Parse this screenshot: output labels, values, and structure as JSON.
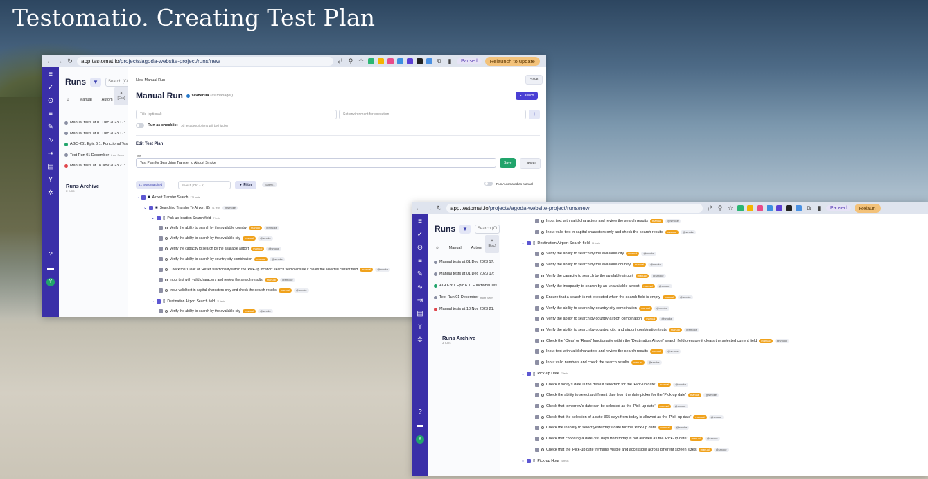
{
  "slide_title": "Testomatio. Creating Test Plan",
  "browser": {
    "url_host": "app.testomat.io",
    "url_path": "/projects/agoda-website-project/runs/new",
    "paused": "Paused",
    "relaunch": "Relaunch to update",
    "relaunch_short": "Relaun"
  },
  "runs_panel": {
    "title": "Runs",
    "search_placeholder": "Search (Ctrl",
    "esc_x": "×",
    "esc_label": "[Esc]",
    "tab_manual": "Manual",
    "tab_auto": "Autom",
    "items": [
      {
        "label": "Manual tests at 01 Dec 2023 17:",
        "color": "#8a8fa3",
        "from": ""
      },
      {
        "label": "Manual tests at 01 Dec 2023 17:",
        "color": "#8a8fa3",
        "from": ""
      },
      {
        "label": "AGO-261 Epic 6.1: Functional Tes",
        "color": "#21a46b",
        "from": ""
      },
      {
        "label": "Test Run 01 December",
        "color": "#8a8fa3",
        "from": "from Seen"
      },
      {
        "label": "Manual tests at 18 Nov 2023 21:",
        "color": "#e0464c",
        "from": ""
      }
    ],
    "archive_title": "Runs Archive",
    "archive_sub": "3 runs"
  },
  "manual_run": {
    "breadcrumb": "New Manual Run",
    "save_top": "Save",
    "title": "Manual Run",
    "manager_name": "Yevheniia",
    "manager_role": "(as manager)",
    "launch": "▸ Launch",
    "title_placeholder": "Title (optional)",
    "env_placeholder": "Set environment for execution",
    "plus": "+",
    "checklist_label": "Run as checklist",
    "checklist_hint": "All test descriptions will be hidden",
    "edit_plan": "Edit Test Plan",
    "title_label": "Title",
    "title_value": "Test Plan for Searching Transfer to Airport Smoke",
    "save": "Save",
    "cancel": "Cancel",
    "tests_matched": "41 tests matched",
    "search_placeholder": "Search [Ctrl + K]",
    "filter": "Filter",
    "suites_badge": "Suites/1",
    "run_automated": "Run Automated as Manual"
  },
  "tree1": [
    {
      "kind": "folder",
      "indent": 0,
      "label": "Airport Transfer Search",
      "count": "173 tests",
      "tag": ""
    },
    {
      "kind": "folder",
      "indent": 1,
      "label": "Searching Transfer To Airport (2)",
      "count": "41 tests",
      "tag": "@smoke"
    },
    {
      "kind": "suite",
      "indent": 2,
      "label": "Pick-up location Search field",
      "count": "7 tests",
      "tag": ""
    },
    {
      "kind": "test",
      "indent": 3,
      "label": "Verify the ability to search by the available country"
    },
    {
      "kind": "test",
      "indent": 3,
      "label": "Verify the ability to search by the available city"
    },
    {
      "kind": "test",
      "indent": 3,
      "label": "Verify the capacity to search by the available airport"
    },
    {
      "kind": "test",
      "indent": 3,
      "label": "Verify the ability to search by country-city combination"
    },
    {
      "kind": "test",
      "indent": 3,
      "label": "Check the 'Clear' or 'Reset' functionality within the 'Pick-up location' search fieldto ensure it clears the selected current field"
    },
    {
      "kind": "test",
      "indent": 3,
      "label": "Input text with valid characters and review the search results"
    },
    {
      "kind": "test",
      "indent": 3,
      "label": "Input valid text in capital characters only and check the search results"
    },
    {
      "kind": "suite",
      "indent": 2,
      "label": "Destination Airport Search field",
      "count": "11 tests",
      "tag": ""
    },
    {
      "kind": "test",
      "indent": 3,
      "label": "Verify the ability to search by the available city"
    }
  ],
  "tree2": [
    {
      "kind": "test",
      "label": "Input text with valid characters and review the search results"
    },
    {
      "kind": "test",
      "label": "Input valid text in capital characters only and check the search results"
    },
    {
      "kind": "suite",
      "label": "Destination Airport Search field",
      "count": "11 tests"
    },
    {
      "kind": "test",
      "label": "Verify the ability to search by the available city"
    },
    {
      "kind": "test",
      "label": "Verify the ability to search by the available country"
    },
    {
      "kind": "test",
      "label": "Verify the capacity to search by the available airport"
    },
    {
      "kind": "test",
      "label": "Verify the incapacity to search by an unavailable airport"
    },
    {
      "kind": "test",
      "label": "Ensure that a search is not executed when the search field is empty"
    },
    {
      "kind": "test",
      "label": "Verify the ability to search by country-city combination"
    },
    {
      "kind": "test",
      "label": "Verify the ability to search by country-airport combination"
    },
    {
      "kind": "test",
      "label": "Verify the ability to search by country, city, and airport combination tests"
    },
    {
      "kind": "test",
      "label": "Check the 'Clear' or 'Reset' functionality within the 'Destination Airport' search fieldto ensure it clears the selected current field"
    },
    {
      "kind": "test",
      "label": "Input text with valid characters and review the search results"
    },
    {
      "kind": "test",
      "label": "Input valid numbers and check the search results"
    },
    {
      "kind": "suite",
      "label": "Pick-up Date",
      "count": "7 tests"
    },
    {
      "kind": "test",
      "label": "Check if today's date is the default selection for the 'Pick-up date'"
    },
    {
      "kind": "test",
      "label": "Check the ability to select a different date from the date picker for the 'Pick-up date'"
    },
    {
      "kind": "test",
      "label": "Check that tomorrow's date can be selected as the 'Pick-up date'"
    },
    {
      "kind": "test",
      "label": "Check that the selection of a date 365 days from today is allowed as the 'Pick-up date'"
    },
    {
      "kind": "test",
      "label": "Check the inability to select yesterday's date for the 'Pick-up date'"
    },
    {
      "kind": "test",
      "label": "Check that choosing a date 366 days from today is not allowed as the 'Pick-up date'"
    },
    {
      "kind": "test",
      "label": "Check that the 'Pick-up date' remains visible and accessible across different screen sizes"
    },
    {
      "kind": "suite",
      "label": "Pick-up Hour",
      "count": "4 tests"
    }
  ],
  "tags": {
    "manual": "manual",
    "smoke": "@smoke"
  },
  "colors": {
    "rail": "#3a2fa8",
    "accent": "#4a3fd4",
    "manual_tag": "#f0a21c",
    "success": "#21a46b"
  }
}
